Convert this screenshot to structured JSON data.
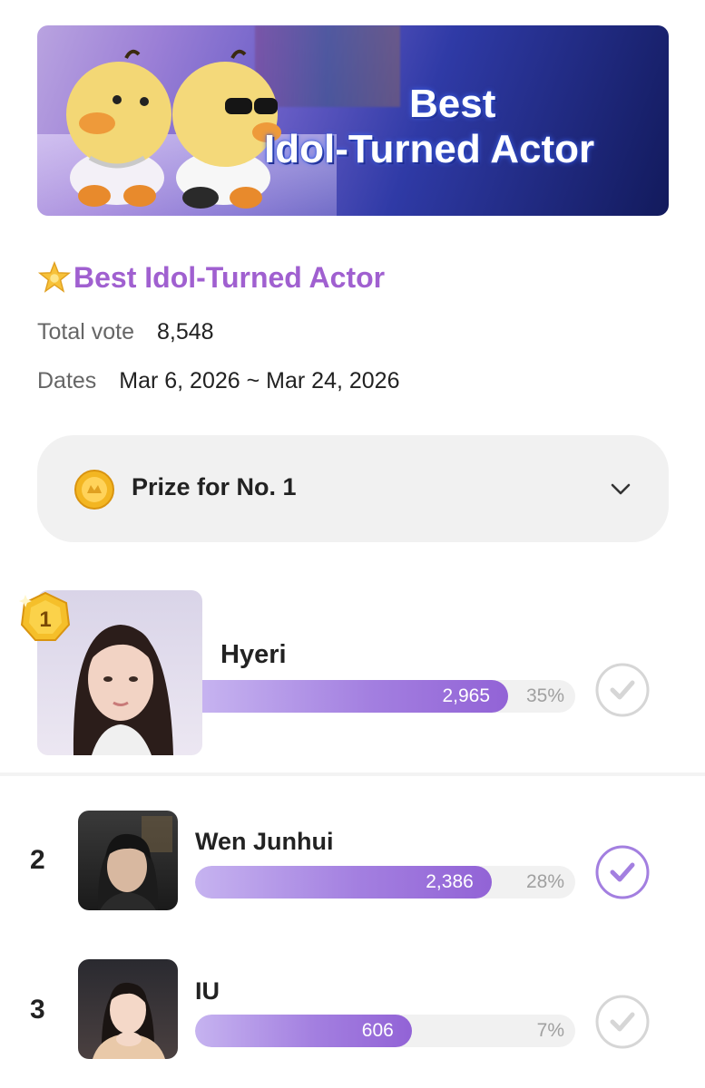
{
  "banner": {
    "line1": "Best",
    "line2": "Idol-Turned Actor"
  },
  "poll": {
    "title": "Best Idol-Turned Actor",
    "total_vote_label": "Total vote",
    "total_vote_value": "8,548",
    "dates_label": "Dates",
    "dates_value": "Mar 6, 2026 ~ Mar 24, 2026"
  },
  "prize": {
    "label": "Prize for No. 1"
  },
  "candidates": [
    {
      "rank": "1",
      "name": "Hyeri",
      "votes": "2,965",
      "percent": "35%",
      "fill_fraction": 0.82,
      "voted": false
    },
    {
      "rank": "2",
      "name": "Wen Junhui",
      "votes": "2,386",
      "percent": "28%",
      "fill_fraction": 0.78,
      "voted": true
    },
    {
      "rank": "3",
      "name": "IU",
      "votes": "606",
      "percent": "7%",
      "fill_fraction": 0.57,
      "voted": false
    }
  ],
  "colors": {
    "accent": "#a060d0",
    "bar_start": "#c6b3f0",
    "bar_end": "#9263d6",
    "check_active": "#a37fe0",
    "check_inactive": "#d6d6d6"
  },
  "icons": [
    "star-sparkle-icon",
    "coin-icon",
    "chevron-down-icon",
    "rank-1-medal-icon",
    "check-circle-icon"
  ]
}
